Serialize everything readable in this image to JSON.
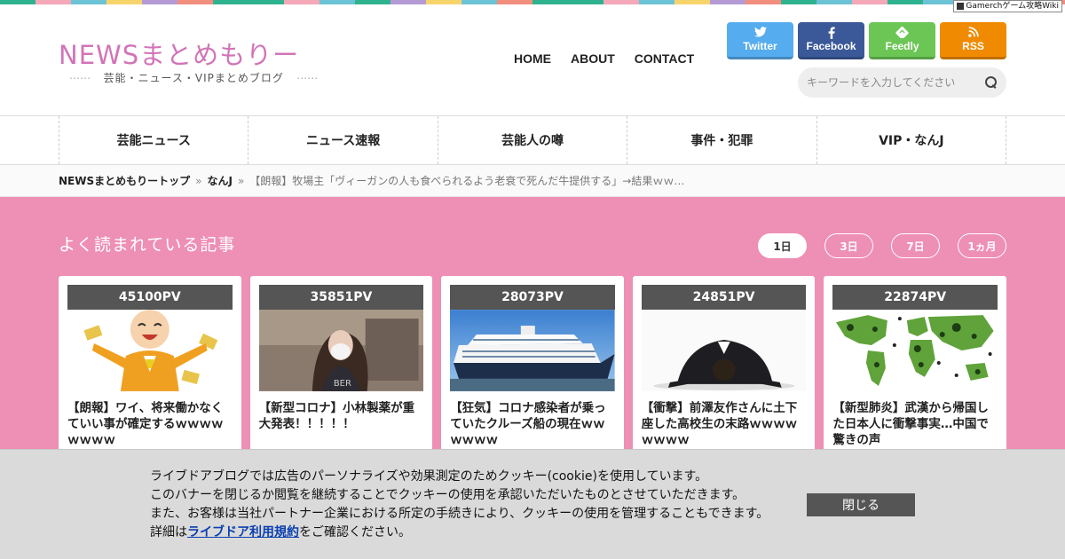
{
  "stripe_colors": [
    "#2fb38f",
    "#f4a8b8",
    "#6cc3d5",
    "#f7d36b",
    "#b49bd6",
    "#f28e7e",
    "#2fb38f",
    "#2fb38f",
    "#f4a8b8",
    "#6cc3d5",
    "#2fb38f",
    "#b49bd6",
    "#f7d36b",
    "#6cc3d5",
    "#f28e7e",
    "#2fb38f",
    "#2fb38f",
    "#f4a8b8",
    "#6cc3d5",
    "#f7d36b",
    "#b49bd6",
    "#f28e7e",
    "#2fb38f",
    "#6cc3d5",
    "#f4a8b8",
    "#2fb38f",
    "#6cc3d5",
    "#f7d36b",
    "#b49bd6",
    "#f28e7e"
  ],
  "badge": {
    "text": "Gamerchゲーム攻略Wiki"
  },
  "site": {
    "logo": "NEWSまとめもりー",
    "tagline_dots": "⋯⋯",
    "tagline": "芸能・ニュース・VIPまとめブログ",
    "logo_color": "#d174b7"
  },
  "topnav": [
    "HOME",
    "ABOUT",
    "CONTACT"
  ],
  "social": [
    {
      "label": "Twitter",
      "icon": "twitter-icon",
      "color": "#55acee"
    },
    {
      "label": "Facebook",
      "icon": "facebook-icon",
      "color": "#3b5998"
    },
    {
      "label": "Feedly",
      "icon": "feedly-icon",
      "color": "#6cc655"
    },
    {
      "label": "RSS",
      "icon": "rss-icon",
      "color": "#f08a00"
    }
  ],
  "search": {
    "placeholder": "キーワードを入力してください"
  },
  "categories": [
    "芸能ニュース",
    "ニュース速報",
    "芸能人の噂",
    "事件・犯罪",
    "VIP・なんJ"
  ],
  "breadcrumb": {
    "home": "NEWSまとめもりートップ",
    "sep": "»",
    "category": "なんJ",
    "current": "【朗報】牧場主「ヴィーガンの人も食べられるよう老衰で死んだ牛提供する」→結果ｗｗ…"
  },
  "popular": {
    "heading": "よく読まれている記事",
    "periods": [
      "1日",
      "3日",
      "7日",
      "1ヵ月"
    ],
    "active_period": "1日",
    "bg_color": "#ee8fb5",
    "articles": [
      {
        "pv": "45100PV",
        "title": "【朗報】ワイ、将来働かなくていい事が確定するｗｗｗｗｗｗｗｗ",
        "image": "happy-man-illustration"
      },
      {
        "pv": "35851PV",
        "title": "【新型コロナ】小林製薬が重大発表！！！！！",
        "image": "masked-woman-photo"
      },
      {
        "pv": "28073PV",
        "title": "【狂気】コロナ感染者が乗っていたクルーズ船の現在ｗｗｗｗｗｗ",
        "image": "cruise-ship-photo"
      },
      {
        "pv": "24851PV",
        "title": "【衝撃】前澤友作さんに土下座した高校生の末路ｗｗｗｗｗｗｗｗ",
        "image": "bowing-man-photo"
      },
      {
        "pv": "22874PV",
        "title": "【新型肺炎】武漢から帰国した日本人に衝撃事実…中国で驚きの声",
        "image": "virus-world-map"
      }
    ]
  },
  "cookie": {
    "line1": "ライブドアブログでは広告のパーソナライズや効果測定のためクッキー(cookie)を使用しています。",
    "line2": "このバナーを閉じるか閲覧を継続することでクッキーの使用を承認いただいたものとさせていただきます。",
    "line3": "また、お客様は当社パートナー企業における所定の手続きにより、クッキーの使用を管理することもできます。",
    "line4_prefix": "詳細は",
    "line4_link": "ライブドア利用規約",
    "line4_suffix": "をご確認ください。",
    "close_label": "閉じる"
  }
}
